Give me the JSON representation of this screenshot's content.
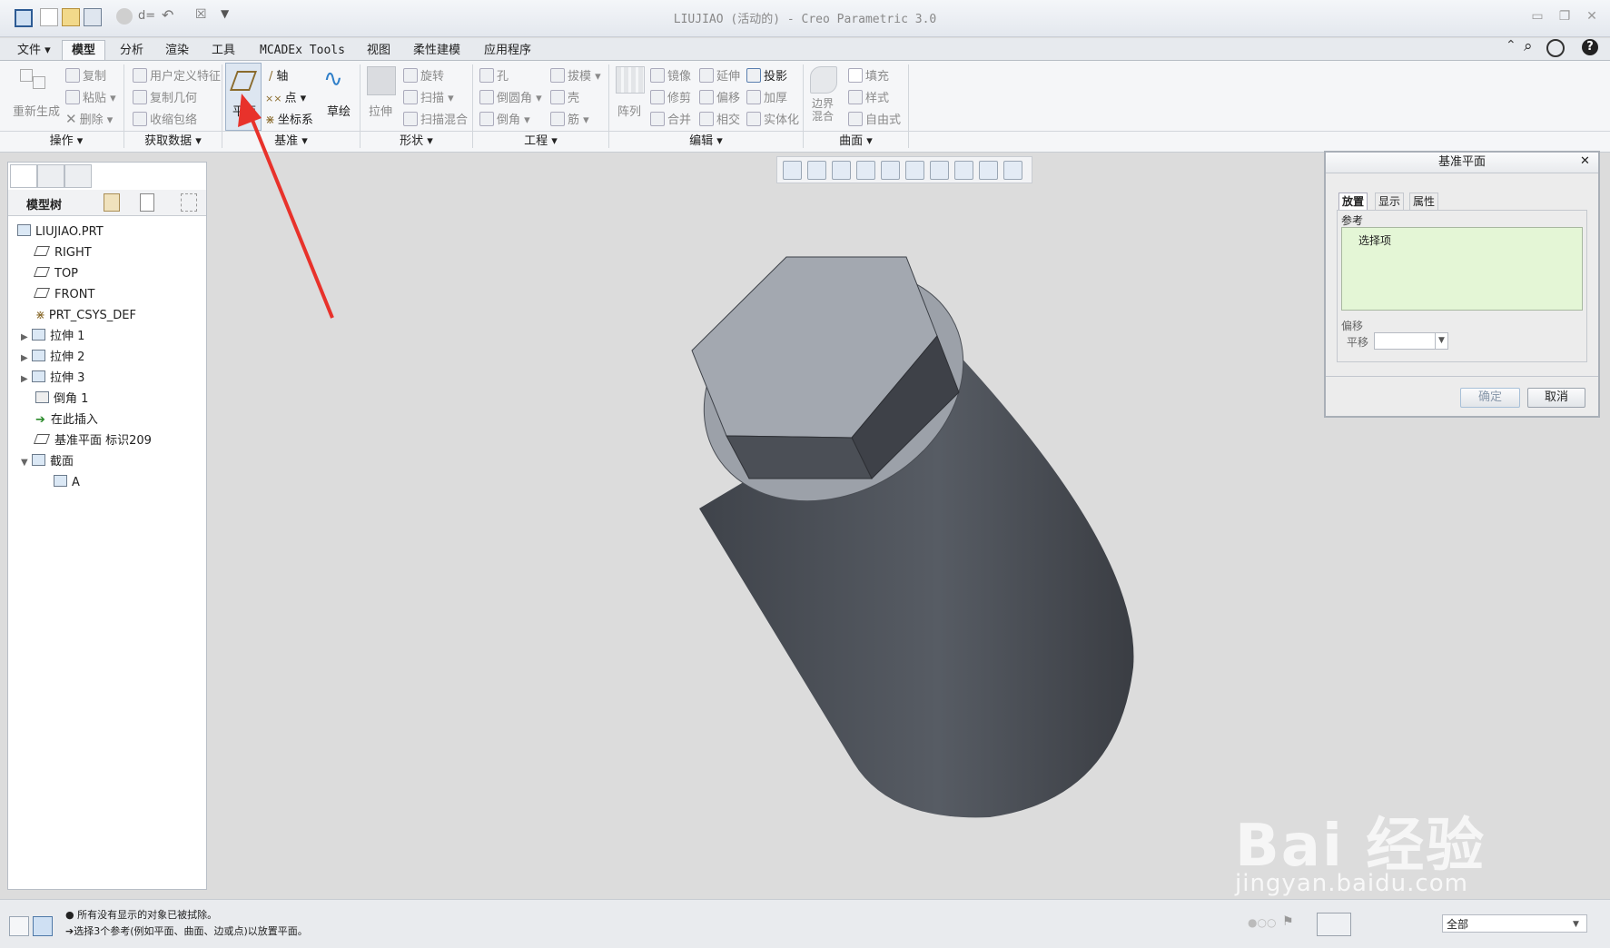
{
  "window": {
    "title": "LIUJIAO (活动的) - Creo Parametric 3.0",
    "min_glyph": "▭",
    "restore_glyph": "❐",
    "close_glyph": "✕"
  },
  "menu_tabs": [
    {
      "label": "文件 ▾"
    },
    {
      "label": "模型"
    },
    {
      "label": "分析"
    },
    {
      "label": "渲染"
    },
    {
      "label": "工具"
    },
    {
      "label": "MCADEx Tools"
    },
    {
      "label": "视图"
    },
    {
      "label": "柔性建模"
    },
    {
      "label": "应用程序"
    }
  ],
  "ribbon": {
    "ops": {
      "regenerate": "重新生成",
      "copy": "复制",
      "paste": "粘贴",
      "delete": "删除"
    },
    "getdata": {
      "udf": "用户定义特征",
      "copygeom": "复制几何",
      "shrinkwrap": "收缩包络"
    },
    "datum": {
      "plane": "平面",
      "axis": "轴",
      "point": "点",
      "csys": "坐标系",
      "sketch": "草绘"
    },
    "shapes": {
      "extrude": "拉伸",
      "revolve": "旋转",
      "sweep": "扫描",
      "sweptblend": "扫描混合"
    },
    "eng": {
      "hole": "孔",
      "round": "倒圆角",
      "chamfer": "倒角",
      "draft": "拔模",
      "shell": "壳",
      "rib": "筋"
    },
    "edit": {
      "pattern": "阵列",
      "mirror": "镜像",
      "trim": "修剪",
      "merge": "合并",
      "extend": "延伸",
      "offset": "偏移",
      "intersect": "相交",
      "project": "投影",
      "thicken": "加厚",
      "solidify": "实体化"
    },
    "surf": {
      "boundary": "边界混合",
      "fill": "填充",
      "style": "样式",
      "freestyle": "自由式"
    },
    "groups": {
      "ops": "操作 ▾",
      "getdata": "获取数据 ▾",
      "datum": "基准 ▾",
      "shapes": "形状 ▾",
      "eng": "工程 ▾",
      "edit": "编辑 ▾",
      "surf": "曲面 ▾"
    }
  },
  "model_tree": {
    "label": "模型树",
    "items": [
      {
        "label": "LIUJIAO.PRT"
      },
      {
        "label": "RIGHT"
      },
      {
        "label": "TOP"
      },
      {
        "label": "FRONT"
      },
      {
        "label": "PRT_CSYS_DEF"
      },
      {
        "label": "拉伸 1"
      },
      {
        "label": "拉伸 2"
      },
      {
        "label": "拉伸 3"
      },
      {
        "label": "倒角 1"
      },
      {
        "label": "在此插入"
      },
      {
        "label": "基准平面 标识209"
      },
      {
        "label": "截面"
      },
      {
        "label": "A"
      }
    ]
  },
  "dialog": {
    "title": "基准平面",
    "tabs": [
      "放置",
      "显示",
      "属性"
    ],
    "references_label": "参考",
    "references_value": "选择项",
    "offset_label": "偏移",
    "translate_label": "平移",
    "ok": "确定",
    "cancel": "取消"
  },
  "status": {
    "line1": "● 所有没有显示的对象已被拭除。",
    "line2": "➔选择3个参考(例如平面、曲面、边或点)以放置平面。",
    "filter": "全部"
  },
  "watermark": {
    "brand": "Bai  经验",
    "url": "jingyan.baidu.com"
  }
}
